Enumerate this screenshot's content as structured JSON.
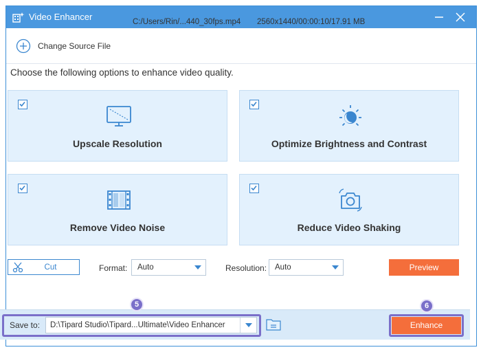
{
  "window": {
    "title": "Video Enhancer",
    "accent_color": "#4a98df",
    "action_color": "#f46e3b",
    "callout_color": "#7a6fc9"
  },
  "source": {
    "change_label": "Change Source File",
    "file_path": "C:/Users/Rin/...440_30fps.mp4",
    "file_meta": "2560x1440/00:00:10/17.91 MB"
  },
  "instruction": "Choose the following options to enhance video quality.",
  "options": [
    {
      "label": "Upscale Resolution",
      "checked": true,
      "icon": "monitor-icon"
    },
    {
      "label": "Optimize Brightness and Contrast",
      "checked": true,
      "icon": "brightness-icon"
    },
    {
      "label": "Remove Video Noise",
      "checked": true,
      "icon": "film-icon"
    },
    {
      "label": "Reduce Video Shaking",
      "checked": true,
      "icon": "camera-stabilize-icon"
    }
  ],
  "controls": {
    "cut_label": "Cut",
    "format_label": "Format:",
    "format_value": "Auto",
    "resolution_label": "Resolution:",
    "resolution_value": "Auto",
    "preview_label": "Preview"
  },
  "bottom": {
    "save_label": "Save to:",
    "save_path": "D:\\Tipard Studio\\Tipard...Ultimate\\Video Enhancer",
    "enhance_label": "Enhance"
  },
  "callouts": {
    "badge_save": "5",
    "badge_enhance": "6"
  }
}
